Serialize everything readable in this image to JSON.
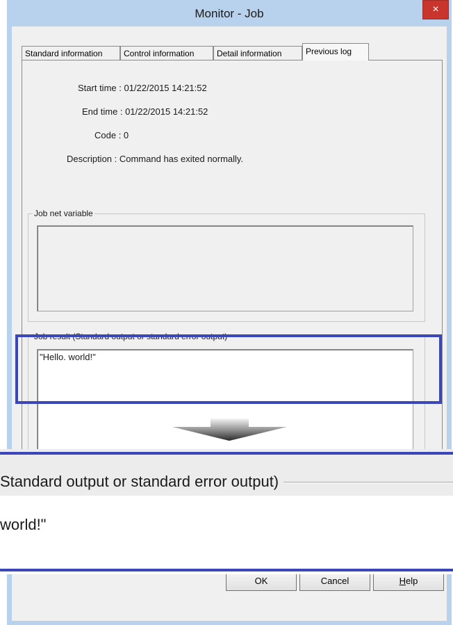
{
  "window": {
    "title": "Monitor - Job",
    "close_glyph": "×"
  },
  "tabs": [
    {
      "label": "Standard information"
    },
    {
      "label": "Control information"
    },
    {
      "label": "Detail information"
    },
    {
      "label": "Previous log",
      "active": true
    }
  ],
  "log": {
    "start_time": "Start time : 01/22/2015 14:21:52",
    "end_time": "End time : 01/22/2015 14:21:52",
    "code": "Code : 0",
    "description": "Description : Command has exited normally."
  },
  "groups": {
    "jobnet_variable": "Job net variable",
    "job_result": "Job result (Standard output or standard error output)",
    "job_result_text": "\"Hello. world!\""
  },
  "zoom": {
    "label": "Standard output or standard error output)",
    "text": "world!\""
  },
  "buttons": {
    "ok": "OK",
    "cancel": "Cancel",
    "help_first": "H",
    "help_rest": "elp"
  },
  "colors": {
    "highlight": "#3b47b9",
    "close": "#c8352c",
    "frame": "#b8d2ee"
  },
  "icons": {
    "close": "close-icon",
    "arrow": "down-arrow-icon"
  }
}
